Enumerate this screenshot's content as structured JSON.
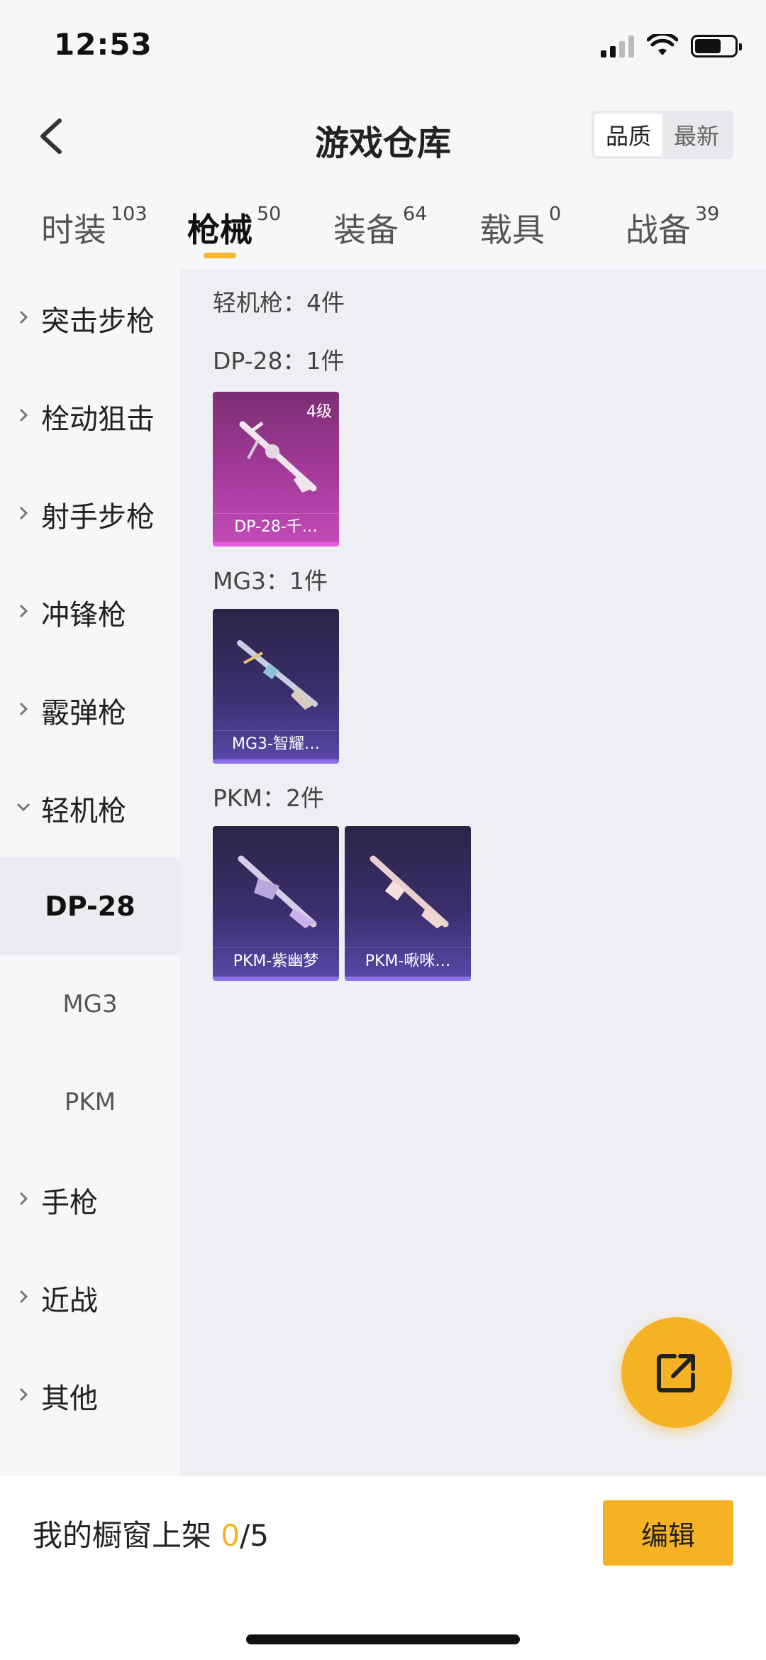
{
  "status": {
    "time": "12:53"
  },
  "nav": {
    "title": "游戏仓库",
    "sort": [
      "品质",
      "最新"
    ]
  },
  "tabs": [
    {
      "label": "时装",
      "count": "103"
    },
    {
      "label": "枪械",
      "count": "50"
    },
    {
      "label": "装备",
      "count": "64"
    },
    {
      "label": "载具",
      "count": "0"
    },
    {
      "label": "战备",
      "count": "39"
    }
  ],
  "sidebar": {
    "items": [
      "突击步枪",
      "栓动狙击",
      "射手步枪",
      "冲锋枪",
      "霰弹枪",
      "轻机枪",
      "手枪",
      "近战",
      "其他"
    ],
    "subitems": [
      "DP-28",
      "MG3",
      "PKM"
    ]
  },
  "content": {
    "category_heading": "轻机枪：4件",
    "groups": [
      {
        "heading": "DP-28：1件",
        "cards": [
          {
            "name": "DP-28-千…",
            "level": "4级"
          }
        ]
      },
      {
        "heading": "MG3：1件",
        "cards": [
          {
            "name": "MG3-智耀…"
          }
        ]
      },
      {
        "heading": "PKM：2件",
        "cards": [
          {
            "name": "PKM-紫幽梦"
          },
          {
            "name": "PKM-啾咪…"
          }
        ]
      }
    ]
  },
  "footer": {
    "label": "我的橱窗上架 ",
    "count": "0",
    "total": "/5",
    "edit_label": "编辑"
  },
  "colors": {
    "accent": "#f5b224",
    "pink_card": "#a63a9c",
    "blue_card": "#3a2f6e"
  }
}
